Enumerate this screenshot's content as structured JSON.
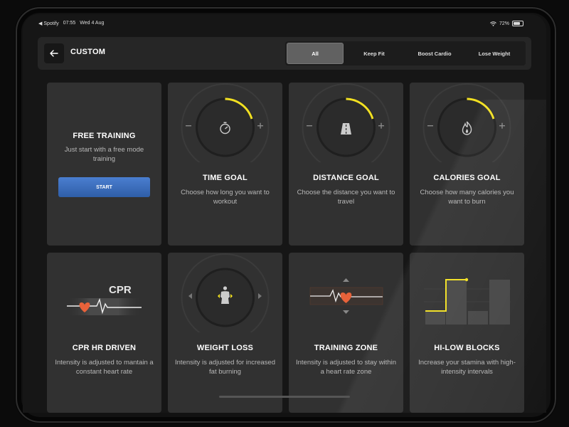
{
  "status_bar": {
    "back_app": "◀ Spotify",
    "time": "07:55",
    "date": "Wed 4 Aug",
    "battery": "72%",
    "battery_level": 0.72
  },
  "header": {
    "title": "CUSTOM",
    "tabs": [
      "All",
      "Keep Fit",
      "Boost Cardio",
      "Lose Weight"
    ],
    "active_tab": "All"
  },
  "cards": [
    {
      "title": "FREE TRAINING",
      "desc": "Just start with a free mode training",
      "button": "START"
    },
    {
      "title": "TIME GOAL",
      "desc": "Choose how long you want to workout",
      "icon": "stopwatch-icon"
    },
    {
      "title": "DISTANCE GOAL",
      "desc": "Choose the distance you want to travel",
      "icon": "road-icon"
    },
    {
      "title": "CALORIES GOAL",
      "desc": "Choose how many calories you want to burn",
      "icon": "flame-icon"
    },
    {
      "title": "CPR HR DRIVEN",
      "desc": "Intensity is adjusted to mantain a constant heart rate",
      "graphic_label": "CPR"
    },
    {
      "title": "WEIGHT LOSS",
      "desc": "Intensity is adjusted for increased fat burning",
      "icon": "body-icon"
    },
    {
      "title": "TRAINING ZONE",
      "desc": "Intensity is adjusted to stay within a heart rate zone",
      "icon": "heart-pulse-icon"
    },
    {
      "title": "HI-LOW BLOCKS",
      "desc": "Increase your stamina with high-intensity intervals",
      "icon": "blocks-icon"
    }
  ],
  "colors": {
    "accent_yellow": "#f2e022",
    "heart_orange": "#e8623a",
    "start_blue": "#3a6fc0"
  }
}
